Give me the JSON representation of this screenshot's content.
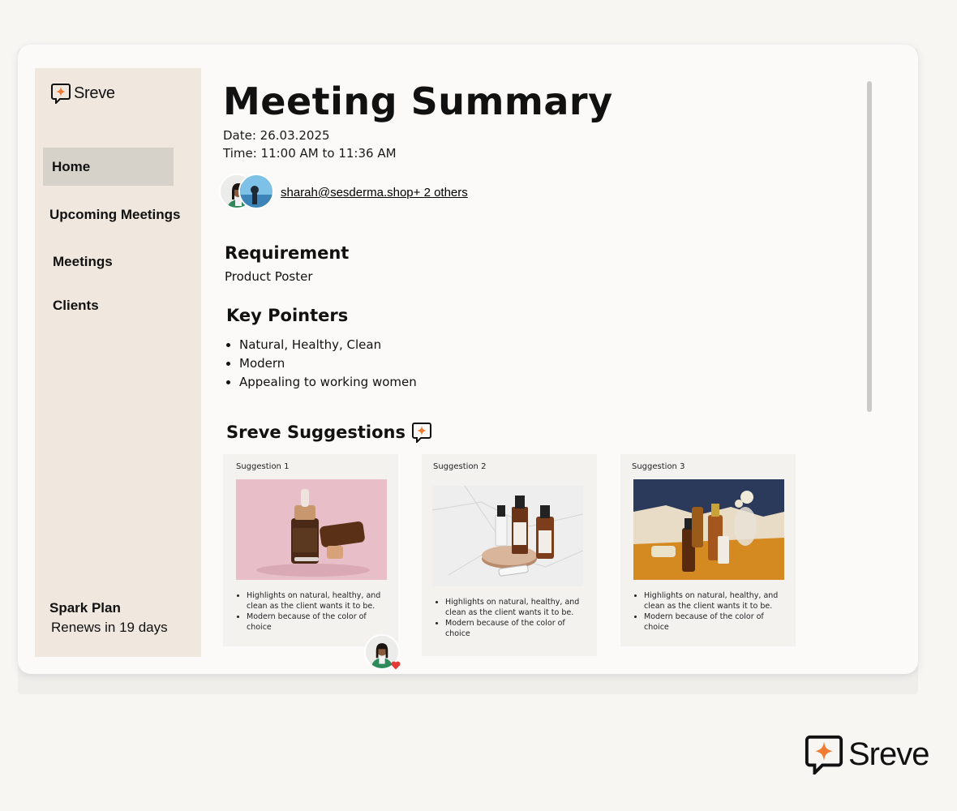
{
  "sidebar": {
    "logo_text": "Sreve",
    "nav": [
      {
        "label": "Home",
        "active": true
      },
      {
        "label": "Upcoming Meetings"
      },
      {
        "label": "Meetings"
      },
      {
        "label": "Clients"
      }
    ],
    "plan": {
      "name": "Spark Plan",
      "renewal": "Renews in 19 days"
    }
  },
  "main": {
    "title": "Meeting Summary",
    "date": "Date: 26.03.2025",
    "time": "Time: 11:00 AM to 11:36 AM",
    "participants": "sharah@sesderma.shop+ 2 others",
    "requirement": {
      "heading": "Requirement",
      "value": "Product Poster"
    },
    "key_pointers": {
      "heading": "Key Pointers",
      "items": [
        "Natural, Healthy, Clean",
        "Modern",
        "Appealing to working women"
      ]
    },
    "suggestions": {
      "heading": "Sreve Suggestions",
      "cards": [
        {
          "label": "Suggestion 1",
          "image": "serum-bottles-on-pink-photo",
          "points": [
            "Highlights on natural, healthy, and clean as the client wants it to be.",
            "Modern because of the color of choice"
          ]
        },
        {
          "label": "Suggestion 2",
          "image": "bottles-on-marble-photo",
          "points": [
            "Highlights on natural, healthy, and clean as the client wants it to be.",
            "Modern because of the color of choice"
          ]
        },
        {
          "label": "Suggestion 3",
          "image": "amber-bottles-on-orange-cloth-photo",
          "points": [
            "Highlights on natural, healthy, and clean as the client wants it to be.",
            "Modern because of the color of choice"
          ]
        }
      ]
    }
  },
  "brand": {
    "text": "Sreve"
  },
  "colors": {
    "accent": "#f07c33",
    "sidebar_bg": "#f0e8df",
    "active_nav": "#d6d2ca",
    "card_bg": "#f4f2ef",
    "reaction_heart": "#e53935"
  },
  "icons": [
    "sreve-logo-icon",
    "sparkle-chat-icon",
    "heart-icon"
  ]
}
